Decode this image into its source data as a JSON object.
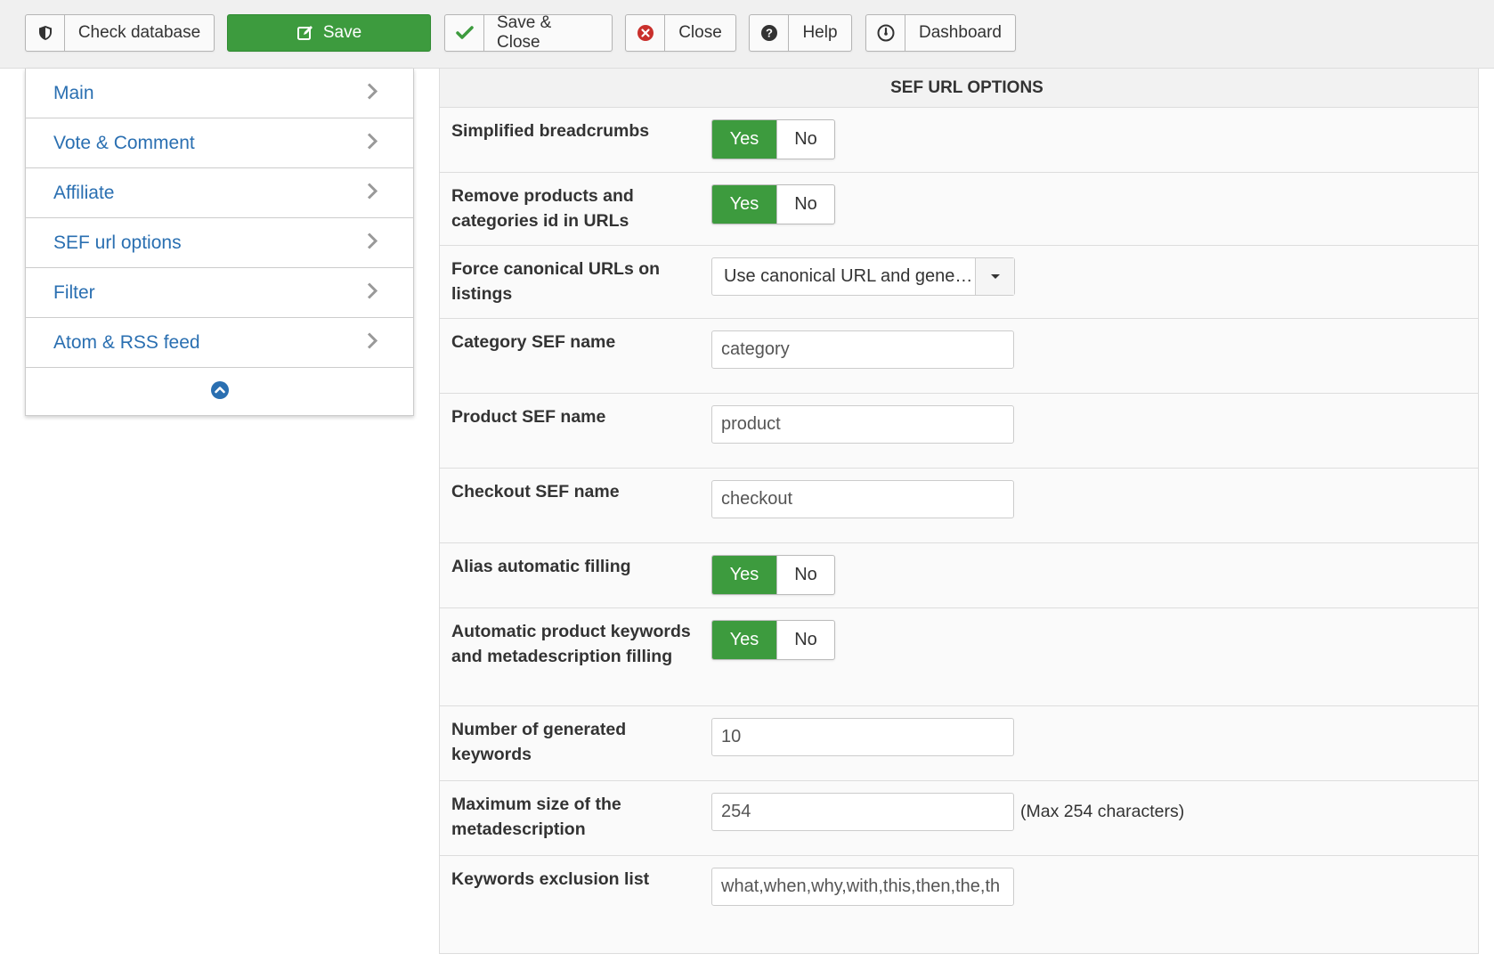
{
  "toolbar": {
    "check_database": "Check database",
    "save": "Save",
    "save_close": "Save & Close",
    "close": "Close",
    "help": "Help",
    "dashboard": "Dashboard"
  },
  "sidebar": {
    "items": [
      {
        "label": "Main"
      },
      {
        "label": "Vote & Comment"
      },
      {
        "label": "Affiliate"
      },
      {
        "label": "SEF url options"
      },
      {
        "label": "Filter"
      },
      {
        "label": "Atom & RSS feed"
      }
    ]
  },
  "panel": {
    "title": "SEF URL OPTIONS",
    "yes": "Yes",
    "no": "No",
    "simplified_breadcrumbs": "Simplified breadcrumbs",
    "remove_ids": "Remove products and categories id in URLs",
    "force_canonical": "Force canonical URLs on listings",
    "force_canonical_value": "Use canonical URL and gene…",
    "category_sef": "Category SEF name",
    "category_sef_value": "category",
    "product_sef": "Product SEF name",
    "product_sef_value": "product",
    "checkout_sef": "Checkout SEF name",
    "checkout_sef_value": "checkout",
    "alias_filling": "Alias automatic filling",
    "auto_keywords": "Automatic product keywords and metadescription filling",
    "num_keywords": "Number of generated keywords",
    "num_keywords_value": "10",
    "max_meta": "Maximum size of the metadescription",
    "max_meta_value": "254",
    "max_meta_hint": "(Max 254 characters)",
    "exclusion": "Keywords exclusion list",
    "exclusion_value": "what,when,why,with,this,then,the,th"
  },
  "colors": {
    "accent_green": "#3d9b3e",
    "link_blue": "#2a6fb1",
    "close_red": "#c9302c"
  }
}
